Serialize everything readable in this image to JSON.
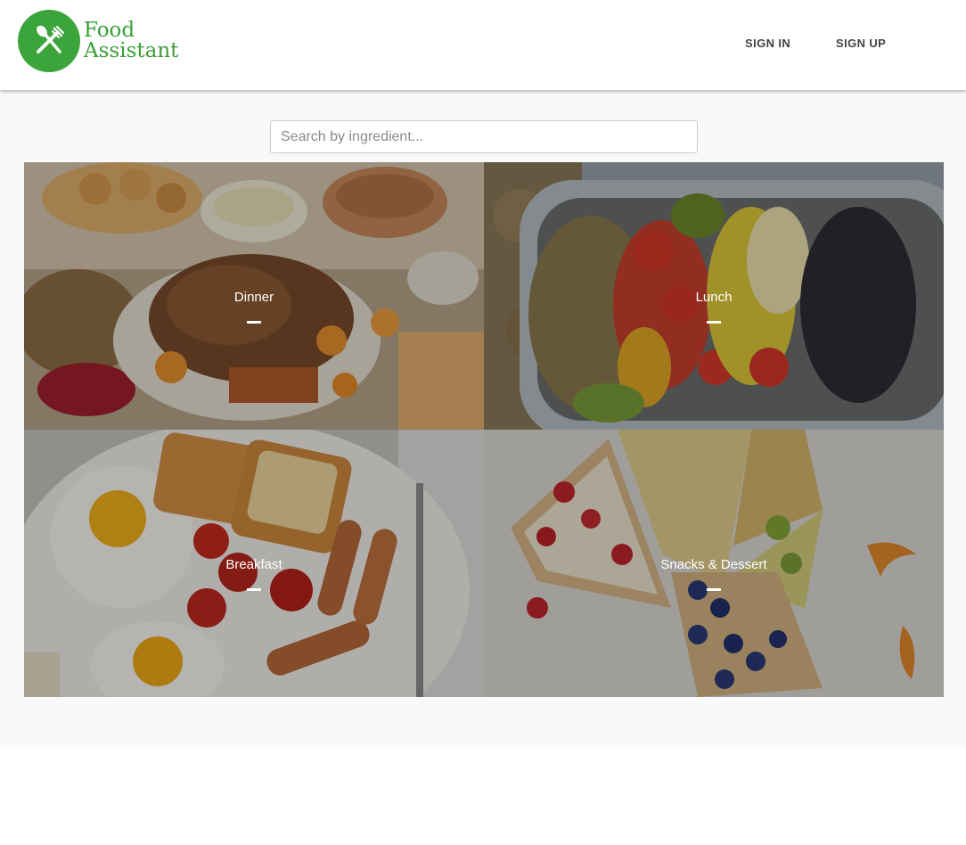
{
  "brand": {
    "line1": "Food",
    "line2": "Assistant",
    "color": "#3ba53b"
  },
  "nav": {
    "sign_in": "SIGN IN",
    "sign_up": "SIGN UP"
  },
  "search": {
    "placeholder": "Search by ingredient...",
    "value": ""
  },
  "categories": [
    {
      "label": "Dinner"
    },
    {
      "label": "Lunch"
    },
    {
      "label": "Breakfast"
    },
    {
      "label": "Snacks & Dessert"
    }
  ]
}
